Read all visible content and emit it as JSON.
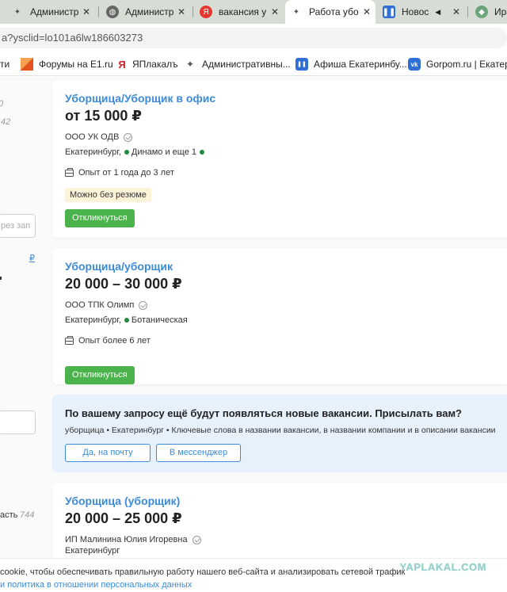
{
  "browser": {
    "tabs": [
      {
        "icon": "browser-extension-icon",
        "label": "Администр",
        "active": false
      },
      {
        "icon": "globe-icon",
        "label": "Администр",
        "active": false
      },
      {
        "icon": "yandex-icon",
        "label": "вакансия у",
        "active": false,
        "color": "#e8372c"
      },
      {
        "icon": "browser-extension-icon",
        "label": "Работа убо",
        "active": true
      },
      {
        "icon": "pause-icon",
        "label": "Новос",
        "active": false,
        "color": "#2f6fd6"
      },
      {
        "icon": "tortoise-icon",
        "label": "Ира",
        "active": false
      }
    ],
    "close_glyph": "✕",
    "speaker_glyph": "◀",
    "address": "a?ysclid=lo101a6lw186603273",
    "bookmarks": [
      {
        "icon": "",
        "label": "ти"
      },
      {
        "icon": "e1-icon",
        "label": "Форумы на E1.ru",
        "color": "#f06a26"
      },
      {
        "icon": "yaplakal-icon",
        "label": "ЯПлакалъ"
      },
      {
        "icon": "browser-extension-icon",
        "label": "Административны..."
      },
      {
        "icon": "pause-icon",
        "label": "Афиша Екатеринбу...",
        "color": "#2f6fd6"
      },
      {
        "icon": "vk-icon",
        "label": "Gorpom.ru | Екатер...",
        "color": "#2f6fd6"
      }
    ]
  },
  "sidebar": {
    "num1": "0",
    "num2": "42",
    "search_placeholder": "рез зап",
    "ruble": "₽",
    "num3": "744",
    "text3": "асть"
  },
  "vacancies": [
    {
      "title": "Уборщица/Уборщик в офис",
      "salary": "от 15 000 ₽",
      "company": "ООО УК ОДВ",
      "city": "Екатеринбург,",
      "metro": "Динамо и еще 1",
      "experience": "Опыт от 1 года до 3 лет",
      "badge": "Можно без резюме",
      "apply": "Откликнуться"
    },
    {
      "title": "Уборщица/уборщик",
      "salary": "20 000 – 30 000 ₽",
      "company": "ООО ТПК Олимп",
      "city": "Екатеринбург,",
      "metro": "Ботаническая",
      "experience": "Опыт более 6 лет",
      "apply": "Откликнуться"
    },
    {
      "title": "Уборщица (уборщик)",
      "salary": "20 000 – 25 000 ₽",
      "company": "ИП Малинина Юлия Игоревна",
      "city": "Екатеринбург"
    }
  ],
  "subscribe": {
    "title": "По вашему запросу ещё будут появляться новые вакансии. Присылать вам?",
    "description": "уборщица • Екатеринбург • Ключевые слова в названии вакансии, в названии компании и в описании вакансии",
    "email_button": "Да, на почту",
    "messenger_button": "В мессенджер"
  },
  "cookie": {
    "line1": "cookie, чтобы обеспечивать правильную работу нашего веб-сайта и анализировать сетевой трафик",
    "line2": "и политика в отношении персональных данных"
  },
  "watermark": "YAPLAKAL.COM"
}
